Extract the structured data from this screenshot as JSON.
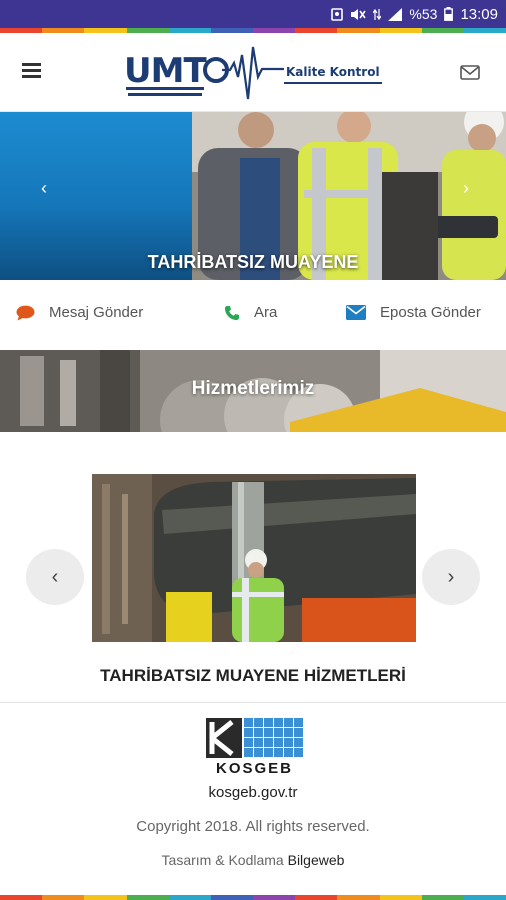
{
  "status_bar": {
    "battery": "%53",
    "time": "13:09"
  },
  "header": {
    "logo_text": "UMT",
    "logo_subtitle": "Kalite Kontrol"
  },
  "hero": {
    "caption": "TAHRİBATSIZ MUAYENE",
    "prev_icon": "‹",
    "next_icon": "›"
  },
  "contact": {
    "items": [
      {
        "label": "Mesaj Gönder",
        "icon": "chat-icon",
        "color": "#e0571b"
      },
      {
        "label": "Ara",
        "icon": "phone-icon",
        "color": "#27a853"
      },
      {
        "label": "Eposta Gönder",
        "icon": "envelope-icon",
        "color": "#1f7ec2"
      }
    ]
  },
  "section": {
    "title": "Hizmetlerimiz"
  },
  "carousel": {
    "prev_icon": "‹",
    "next_icon": "›",
    "service_title": "TAHRİBATSIZ MUAYENE HİZMETLERİ"
  },
  "footer": {
    "kosgeb_name": "KOSGEB",
    "kosgeb_site": "kosgeb.gov.tr",
    "copyright": "Copyright 2018. All rights reserved.",
    "credits_prefix": "Tasarım & Kodlama",
    "credits_brand": "Bilgeweb"
  },
  "colors": {
    "status_bar": "#3d3591",
    "brand_navy": "#1d3c74",
    "rainbow": [
      "#e8452c",
      "#f08b1d",
      "#f4c31b",
      "#4cae4f",
      "#2aa7c9",
      "#3f62b8",
      "#8e44ad",
      "#e8452c",
      "#f08b1d",
      "#f4c31b",
      "#4cae4f",
      "#2aa7c9"
    ]
  }
}
